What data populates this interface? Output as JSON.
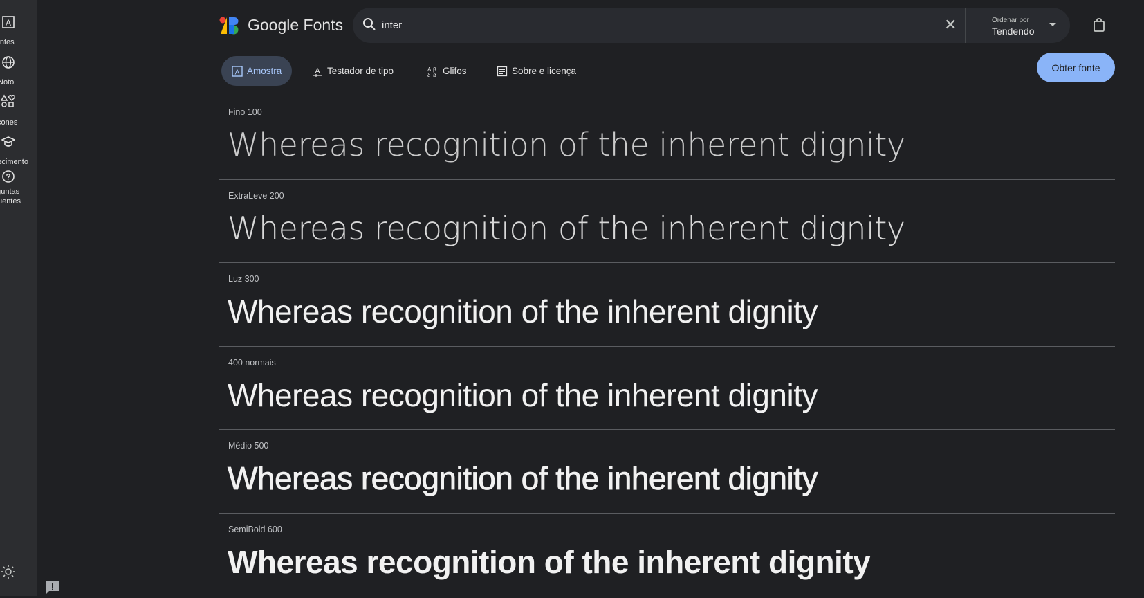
{
  "sidebar": {
    "items": [
      {
        "label": "Fontes",
        "icon": "font-box-icon"
      },
      {
        "label": "Noto",
        "icon": "globe-icon"
      },
      {
        "label": "Ícones",
        "icon": "shapes-icon"
      },
      {
        "label": "Conhecimento",
        "icon": "graduation-cap-icon"
      },
      {
        "label": "Perguntas frequentes",
        "icon": "help-circle-icon"
      }
    ],
    "theme_icon": "sun-icon",
    "feedback_icon": "feedback-icon"
  },
  "header": {
    "brand": "Google Fonts",
    "search": {
      "value": "inter"
    },
    "sort": {
      "label": "Ordenar por",
      "value": "Tendendo"
    }
  },
  "tabs": [
    {
      "label": "Amostra",
      "active": true
    },
    {
      "label": "Testador de tipo"
    },
    {
      "label": "Glifos"
    },
    {
      "label": "Sobre e licença"
    }
  ],
  "get_font": "Obter fonte",
  "colors": {
    "accent": "#8ab4f8",
    "bg": "#1f2023",
    "sidebar": "#2c2d30"
  },
  "sample_text": "Whereas recognition of the inherent dignity",
  "styles": [
    {
      "label": "Fino 100",
      "weight": 100
    },
    {
      "label": "ExtraLeve 200",
      "weight": 200
    },
    {
      "label": "Luz 300",
      "weight": 300
    },
    {
      "label": "400 normais",
      "weight": 400
    },
    {
      "label": "Médio 500",
      "weight": 500
    },
    {
      "label": "SemiBold 600",
      "weight": 600
    }
  ]
}
